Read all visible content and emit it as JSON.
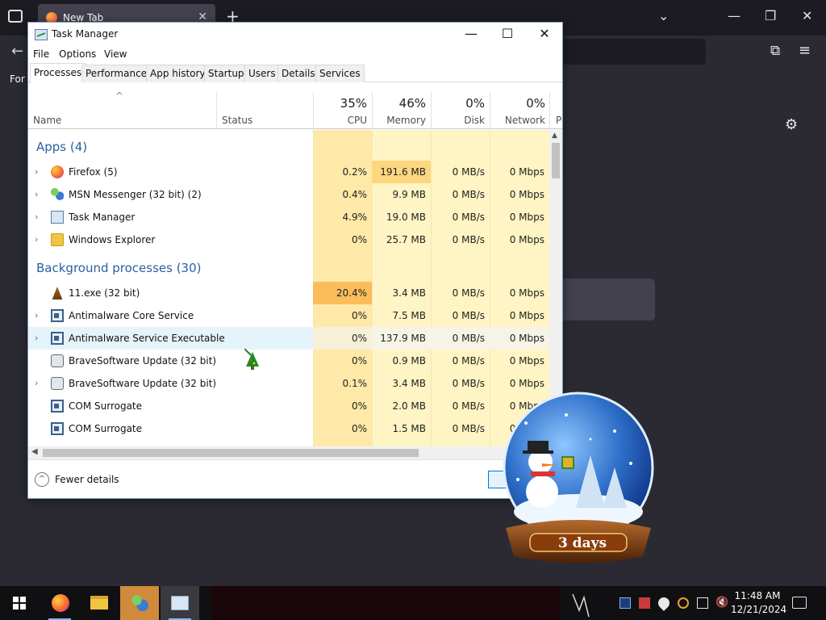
{
  "browser": {
    "tab_title": "New Tab",
    "bookmarks_text": "For"
  },
  "task_manager": {
    "title": "Task Manager",
    "menu": [
      "File",
      "Options",
      "View"
    ],
    "tabs": [
      "Processes",
      "Performance",
      "App history",
      "Startup",
      "Users",
      "Details",
      "Services"
    ],
    "active_tab": "Processes",
    "columns": {
      "name": "Name",
      "status": "Status",
      "cpu": {
        "pct": "35%",
        "label": "CPU"
      },
      "memory": {
        "pct": "46%",
        "label": "Memory"
      },
      "disk": {
        "pct": "0%",
        "label": "Disk"
      },
      "network": {
        "pct": "0%",
        "label": "Network"
      },
      "power_truncated": "P"
    },
    "groups": {
      "apps": "Apps (4)",
      "background": "Background processes (30)"
    },
    "rows": [
      {
        "name": "Firefox (5)",
        "icon": "firefox-icon",
        "expand": true,
        "cpu": "0.2%",
        "memory": "191.6 MB",
        "disk": "0 MB/s",
        "network": "0 Mbps"
      },
      {
        "name": "MSN Messenger (32 bit) (2)",
        "icon": "msn-messenger-icon",
        "expand": true,
        "cpu": "0.4%",
        "memory": "9.9 MB",
        "disk": "0 MB/s",
        "network": "0 Mbps"
      },
      {
        "name": "Task Manager",
        "icon": "task-manager-icon",
        "expand": true,
        "cpu": "4.9%",
        "memory": "19.0 MB",
        "disk": "0 MB/s",
        "network": "0 Mbps"
      },
      {
        "name": "Windows Explorer",
        "icon": "windows-explorer-icon",
        "expand": true,
        "cpu": "0%",
        "memory": "25.7 MB",
        "disk": "0 MB/s",
        "network": "0 Mbps"
      },
      {
        "name": "11.exe (32 bit)",
        "icon": "exe-icon",
        "expand": false,
        "cpu": "20.4%",
        "memory": "3.4 MB",
        "disk": "0 MB/s",
        "network": "0 Mbps"
      },
      {
        "name": "Antimalware Core Service",
        "icon": "service-icon",
        "expand": true,
        "cpu": "0%",
        "memory": "7.5 MB",
        "disk": "0 MB/s",
        "network": "0 Mbps"
      },
      {
        "name": "Antimalware Service Executable",
        "icon": "service-icon",
        "expand": true,
        "cpu": "0%",
        "memory": "137.9 MB",
        "disk": "0 MB/s",
        "network": "0 Mbps"
      },
      {
        "name": "BraveSoftware Update (32 bit)",
        "icon": "brave-update-icon",
        "expand": false,
        "cpu": "0%",
        "memory": "0.9 MB",
        "disk": "0 MB/s",
        "network": "0 Mbps"
      },
      {
        "name": "BraveSoftware Update (32 bit)",
        "icon": "brave-update-icon",
        "expand": true,
        "cpu": "0.1%",
        "memory": "3.4 MB",
        "disk": "0 MB/s",
        "network": "0 Mbps"
      },
      {
        "name": "COM Surrogate",
        "icon": "service-icon",
        "expand": false,
        "cpu": "0%",
        "memory": "2.0 MB",
        "disk": "0 MB/s",
        "network": "0 Mbps"
      },
      {
        "name": "COM Surrogate",
        "icon": "service-icon",
        "expand": false,
        "cpu": "0%",
        "memory": "1.5 MB",
        "disk": "0 MB/s",
        "network": "0 Mbps"
      }
    ],
    "fewer_details": "Fewer details"
  },
  "snow_globe": {
    "label": "3 days"
  },
  "taskbar": {
    "time": "11:48 AM",
    "date": "12/21/2024"
  },
  "colors": {
    "group_title": "#2b5fa3",
    "cpu_hot": "#fbbd5a",
    "heat_light": "#fff4c4",
    "heat_mid": "#ffe9a8",
    "heat_strong": "#fdd77f",
    "taskbar_active": "#cf8a3b"
  }
}
